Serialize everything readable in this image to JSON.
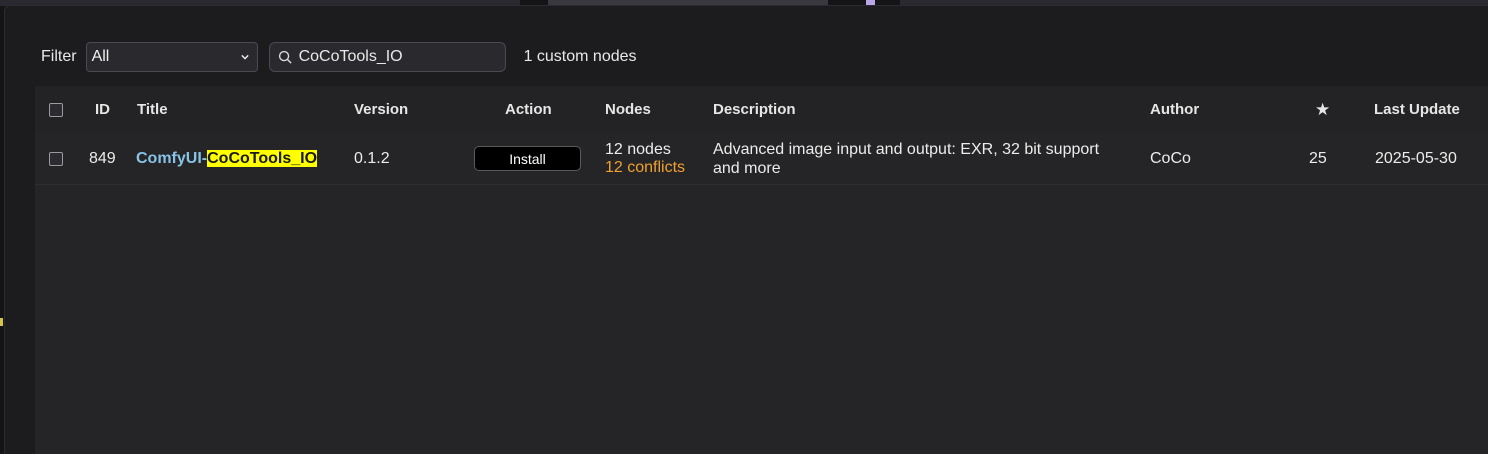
{
  "toolbar": {
    "filter_label": "Filter",
    "filter_value": "All",
    "search_value": "CoCoTools_IO",
    "result_count": "1 custom nodes"
  },
  "table": {
    "headers": {
      "id": "ID",
      "title": "Title",
      "version": "Version",
      "action": "Action",
      "nodes": "Nodes",
      "description": "Description",
      "author": "Author",
      "stars": "★",
      "last_update": "Last Update"
    },
    "rows": [
      {
        "id": "849",
        "title_prefix": "ComfyUI-",
        "title_match": "CoCoTools_IO",
        "version": "0.1.2",
        "action": "Install",
        "nodes": "12 nodes",
        "conflicts": "12 conflicts",
        "description": "Advanced image input and output: EXR, 32 bit support and more",
        "author": "CoCo",
        "stars": "25",
        "last_update": "2025-05-30"
      }
    ]
  },
  "colors": {
    "link": "#86c3e6",
    "highlight": "#ffff00",
    "conflict": "#f0a030",
    "background": "#252527"
  }
}
